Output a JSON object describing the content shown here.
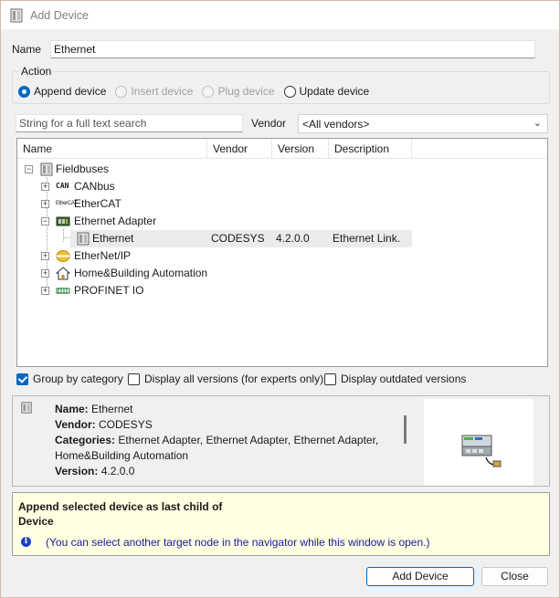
{
  "window": {
    "title": "Add Device"
  },
  "name_field": {
    "label": "Name",
    "value": "Ethernet"
  },
  "action": {
    "legend": "Action",
    "options": [
      {
        "label": "Append device",
        "checked": true,
        "enabled": true
      },
      {
        "label": "Insert device",
        "checked": false,
        "enabled": false
      },
      {
        "label": "Plug device",
        "checked": false,
        "enabled": false
      },
      {
        "label": "Update device",
        "checked": false,
        "enabled": true
      }
    ]
  },
  "search": {
    "placeholder": "String for a full text search",
    "value": ""
  },
  "vendor": {
    "label": "Vendor",
    "selected": "<All vendors>"
  },
  "tree": {
    "columns": [
      "Name",
      "Vendor",
      "Version",
      "Description"
    ],
    "rows": [
      {
        "label": "Fieldbuses",
        "icon": "fieldbus-icon",
        "expander": "−",
        "vendor": "",
        "version": "",
        "description": ""
      },
      {
        "label": "CANbus",
        "icon": "can-icon",
        "icon_text": "CAN",
        "expander": "+",
        "vendor": "",
        "version": "",
        "description": ""
      },
      {
        "label": "EtherCAT",
        "icon": "ethercat-icon",
        "icon_text": "EtherCAT",
        "expander": "+",
        "vendor": "",
        "version": "",
        "description": ""
      },
      {
        "label": "Ethernet Adapter",
        "icon": "ethernet-adapter-icon",
        "expander": "−",
        "vendor": "",
        "version": "",
        "description": ""
      },
      {
        "label": "Ethernet",
        "icon": "device-icon",
        "expander": "",
        "vendor": "CODESYS",
        "version": "4.2.0.0",
        "description": "Ethernet Link."
      },
      {
        "label": "EtherNet/IP",
        "icon": "ethernetip-icon",
        "expander": "+",
        "vendor": "",
        "version": "",
        "description": ""
      },
      {
        "label": "Home&Building Automation",
        "icon": "home-icon",
        "expander": "+",
        "vendor": "",
        "version": "",
        "description": ""
      },
      {
        "label": "PROFINET IO",
        "icon": "profinet-icon",
        "expander": "+",
        "vendor": "",
        "version": "",
        "description": ""
      }
    ]
  },
  "options": {
    "group_by_category": {
      "label": "Group by category",
      "checked": true
    },
    "display_all_versions": {
      "label": "Display all versions (for experts only)",
      "checked": false
    },
    "display_outdated": {
      "label": "Display outdated versions",
      "checked": false
    }
  },
  "info": {
    "name_key": "Name:",
    "name_val": "Ethernet",
    "vendor_key": "Vendor:",
    "vendor_val": "CODESYS",
    "categories_key": "Categories:",
    "categories_val": "Ethernet Adapter, Ethernet Adapter, Ethernet Adapter,",
    "categories_val2": "Home&Building Automation",
    "version_key": "Version:",
    "version_val": "4.2.0.0"
  },
  "message": {
    "title_line1": "Append selected device as last child of",
    "title_line2": "Device",
    "note": "(You can select another target node in the navigator while this window is open.)"
  },
  "buttons": {
    "add": "Add Device",
    "close": "Close"
  }
}
